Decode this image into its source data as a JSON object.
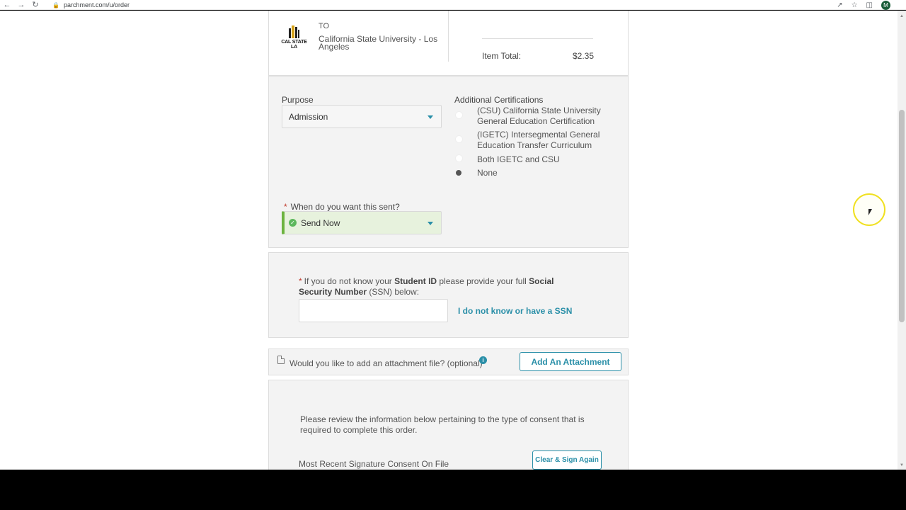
{
  "browser": {
    "url": "parchment.com/u/order",
    "profile_initial": "M"
  },
  "order": {
    "to_label": "TO",
    "logo_text": "CAL STATE LA",
    "school_name": "California State University - Los Angeles",
    "item_total_label": "Item Total:",
    "item_total_value": "$2.35"
  },
  "purpose": {
    "label": "Purpose",
    "selected": "Admission"
  },
  "certifications": {
    "label": "Additional Certifications",
    "options": [
      {
        "label": "(CSU) California State University General Education Certification",
        "checked": false
      },
      {
        "label": "(IGETC) Intersegmental General Education Transfer Curriculum",
        "checked": false
      },
      {
        "label": "Both IGETC and CSU",
        "checked": false
      },
      {
        "label": "None",
        "checked": true
      }
    ]
  },
  "send_timing": {
    "required_mark": "*",
    "label": "When do you want this sent?",
    "selected": "Send Now"
  },
  "ssn": {
    "required_mark": "*",
    "text_1": "If you do not know your ",
    "bold_1": "Student ID",
    "text_2": " please provide your full ",
    "bold_2": "Social Security Number",
    "text_3": " (SSN) below:",
    "input_value": "",
    "no_ssn_link": "I do not know or have a SSN"
  },
  "attachment": {
    "question": "Would you like to add an attachment file? (optional)",
    "button_label": "Add An Attachment"
  },
  "consent": {
    "instructions": "Please review the information below pertaining to the type of consent that is required to complete this order.",
    "signature_label": "Most Recent Signature Consent On File",
    "clear_button": "Clear & Sign Again"
  },
  "colors": {
    "accent": "#2a8fa8",
    "success": "#5cb85c",
    "required": "#c0392b"
  }
}
